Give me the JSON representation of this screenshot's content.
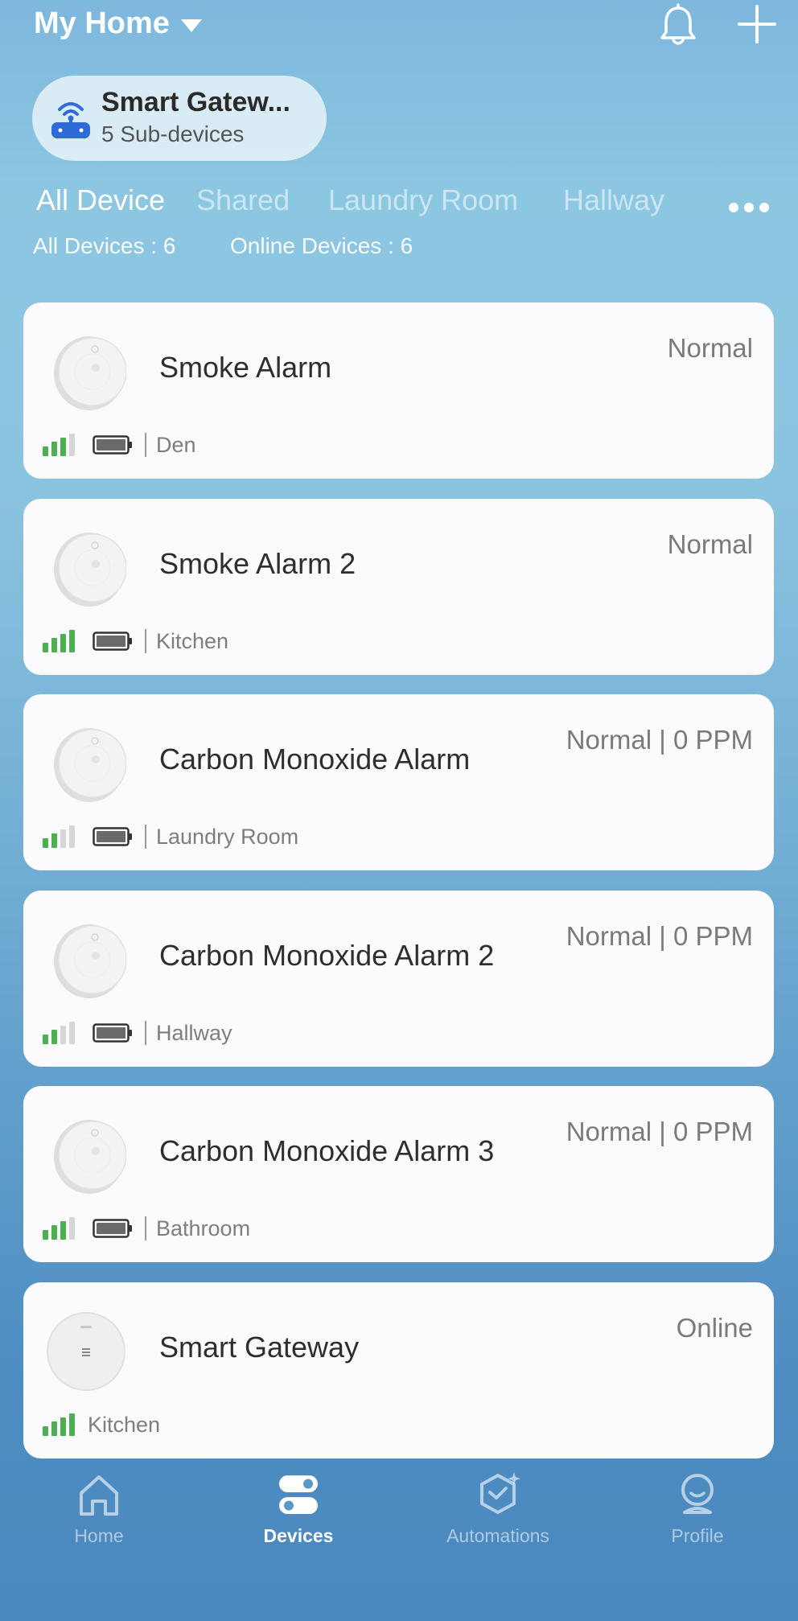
{
  "header": {
    "home_title": "My Home"
  },
  "gateway_pill": {
    "name": "Smart Gatew...",
    "sub": "5 Sub-devices"
  },
  "tabs": [
    {
      "label": "All Device",
      "active": true
    },
    {
      "label": "Shared",
      "active": false
    },
    {
      "label": "Laundry Room",
      "active": false
    },
    {
      "label": "Hallway",
      "active": false
    }
  ],
  "counts": {
    "all": "All Devices : 6",
    "online": "Online Devices : 6"
  },
  "devices": [
    {
      "name": "Smoke Alarm",
      "status": "Normal",
      "room": "Den",
      "signal_bars": 3,
      "icon": "smoke-alarm-icon"
    },
    {
      "name": "Smoke Alarm 2",
      "status": "Normal",
      "room": "Kitchen",
      "signal_bars": 4,
      "icon": "smoke-alarm-icon"
    },
    {
      "name": "Carbon Monoxide Alarm",
      "status": "Normal | 0 PPM",
      "room": "Laundry Room",
      "signal_bars": 2,
      "icon": "co-alarm-icon"
    },
    {
      "name": "Carbon Monoxide Alarm 2",
      "status": "Normal | 0 PPM",
      "room": "Hallway",
      "signal_bars": 2,
      "icon": "co-alarm-icon"
    },
    {
      "name": "Carbon Monoxide Alarm 3",
      "status": "Normal | 0 PPM",
      "room": "Bathroom",
      "signal_bars": 3,
      "icon": "co-alarm-icon"
    },
    {
      "name": "Smart Gateway",
      "status": "Online",
      "room": "Kitchen",
      "signal_bars": 4,
      "icon": "gateway-icon"
    }
  ],
  "nav": [
    {
      "label": "Home",
      "icon": "home-icon",
      "active": false
    },
    {
      "label": "Devices",
      "icon": "devices-icon",
      "active": true
    },
    {
      "label": "Automations",
      "icon": "automations-icon",
      "active": false
    },
    {
      "label": "Profile",
      "icon": "profile-icon",
      "active": false
    }
  ],
  "colors": {
    "signal_active": "#4caf50",
    "signal_inactive": "#d6d6d6",
    "gateway_accent": "#2f6bd8"
  }
}
